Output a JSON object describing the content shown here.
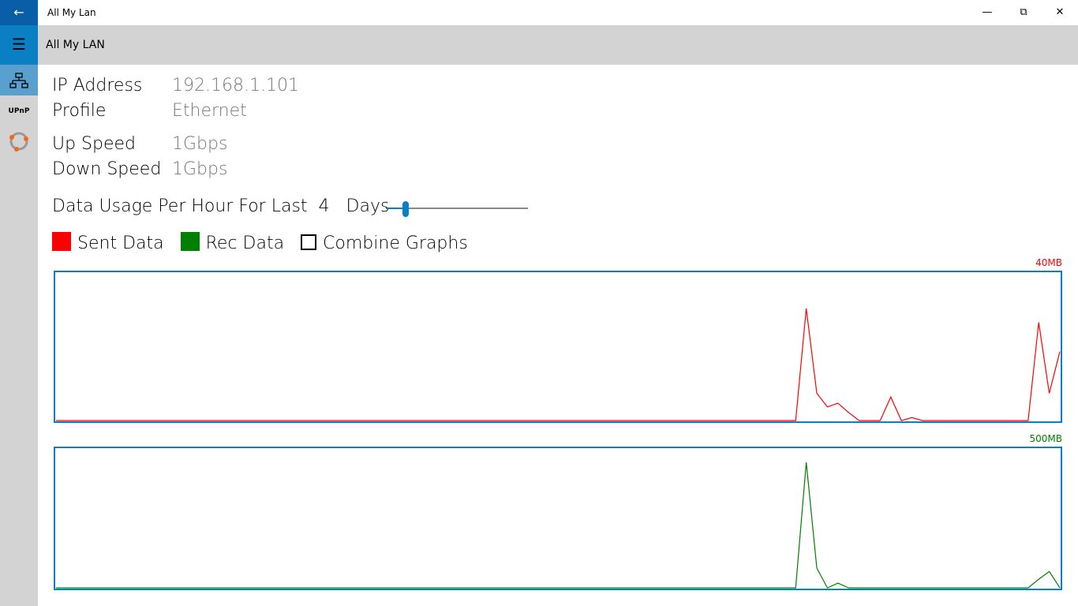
{
  "window": {
    "title": "All My Lan",
    "back_icon": "arrow-left-icon",
    "controls": [
      "minimize",
      "restore",
      "close"
    ]
  },
  "header": {
    "title": "All My LAN",
    "menu_icon": "hamburger-icon"
  },
  "sidebar": {
    "items": [
      {
        "icon": "network-icon",
        "active": true
      },
      {
        "icon": "upnp-icon",
        "label": "UPnP"
      },
      {
        "icon": "bonjour-icon"
      }
    ]
  },
  "info": {
    "ip_label": "IP Address",
    "ip_value": "192.168.1.101",
    "profile_label": "Profile",
    "profile_value": "Ethernet",
    "up_label": "Up Speed",
    "up_value": "1Gbps",
    "down_label": "Down Speed",
    "down_value": "1Gbps"
  },
  "usage": {
    "label": "Data Usage Per Hour For Last",
    "days": "4",
    "days_label": "Days",
    "slider_fraction": 0.12
  },
  "legend": {
    "sent": "Sent Data",
    "sent_color": "#ff0000",
    "rec": "Rec Data",
    "rec_color": "#008000",
    "combine": "Combine Graphs",
    "combine_checked": false
  },
  "chart_data": [
    {
      "type": "line",
      "series": [
        {
          "name": "Sent Data",
          "color": "#ff0000",
          "values": [
            0,
            0,
            0,
            0,
            0,
            0,
            0,
            0,
            0,
            0,
            0,
            0,
            0,
            0,
            0,
            0,
            0,
            0,
            0,
            0,
            0,
            0,
            0,
            0,
            0,
            0,
            0,
            0,
            0,
            0,
            0,
            0,
            0,
            0,
            0,
            0,
            0,
            0,
            0,
            0,
            0,
            0,
            0,
            0,
            0,
            0,
            0,
            0,
            0,
            0,
            0,
            0,
            0,
            0,
            0,
            0,
            0,
            0,
            0,
            0,
            0,
            0,
            0,
            0,
            0,
            0,
            0,
            0,
            0,
            0,
            0,
            30.4,
            7.4,
            3.7,
            4.7,
            2.2,
            0,
            0,
            0,
            6.4,
            0,
            0.8,
            0,
            0,
            0,
            0,
            0,
            0,
            0,
            0,
            0,
            0,
            0,
            26.6,
            7.4,
            18.7
          ]
        }
      ],
      "ylim": [
        0,
        40
      ],
      "max_label": "40MB"
    },
    {
      "type": "line",
      "series": [
        {
          "name": "Rec Data",
          "color": "#008000",
          "values": [
            0,
            0,
            0,
            0,
            0,
            0,
            0,
            0,
            0,
            0,
            0,
            0,
            0,
            0,
            0,
            0,
            0,
            0,
            0,
            0,
            0,
            0,
            0,
            0,
            0,
            0,
            0,
            0,
            0,
            0,
            0,
            0,
            0,
            0,
            0,
            0,
            0,
            0,
            0,
            0,
            0,
            0,
            0,
            0,
            0,
            0,
            0,
            0,
            0,
            0,
            0,
            0,
            0,
            0,
            0,
            0,
            0,
            0,
            0,
            0,
            0,
            0,
            0,
            0,
            0,
            0,
            0,
            0,
            0,
            0,
            0,
            452,
            71,
            0,
            17,
            0,
            0,
            0,
            0,
            0,
            0,
            0,
            0,
            0,
            0,
            0,
            0,
            0,
            0,
            0,
            0,
            0,
            0,
            31,
            59,
            0
          ]
        }
      ],
      "ylim": [
        0,
        500
      ],
      "max_label": "500MB"
    }
  ]
}
